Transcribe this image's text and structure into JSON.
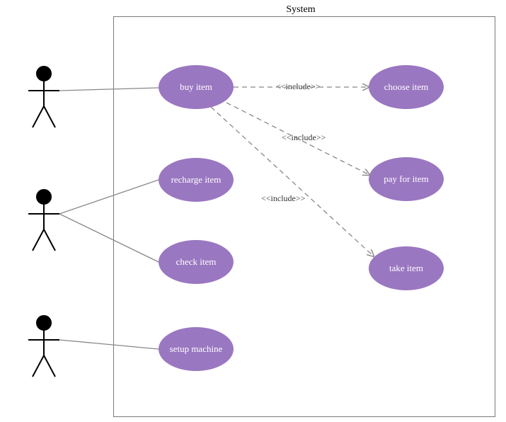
{
  "system": {
    "label": "System"
  },
  "usecases": {
    "buy": "buy item",
    "recharge": "recharge  item",
    "check": "check  item",
    "setup": "setup machine",
    "choose": "choose  item",
    "pay": "pay for item",
    "take": "take item"
  },
  "includes": {
    "l1": "<<include>>",
    "l2": "<<include>>",
    "l3": "<<include>>"
  }
}
